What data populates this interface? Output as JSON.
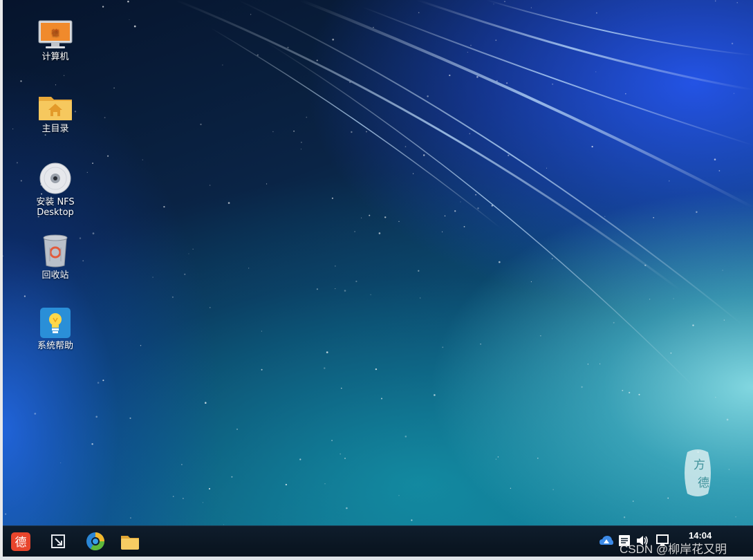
{
  "desktop": {
    "icons": [
      {
        "label": "计算机",
        "icon": "computer-icon"
      },
      {
        "label": "主目录",
        "icon": "home-folder-icon"
      },
      {
        "label": "安装 NFS",
        "label2": "Desktop",
        "icon": "disc-icon"
      },
      {
        "label": "回收站",
        "icon": "trash-icon"
      },
      {
        "label": "系统帮助",
        "icon": "lightbulb-icon"
      }
    ],
    "seal_text": "方德"
  },
  "taskbar": {
    "start_button_glyph": "德",
    "clock": "14:04",
    "buttons": [
      "show-desktop-icon",
      "browser-icon",
      "file-manager-icon"
    ],
    "tray": [
      "cloud-icon",
      "notes-icon",
      "volume-icon",
      "network-icon"
    ]
  },
  "watermark": "CSDN @柳岸花又明",
  "colors": {
    "taskbar": "#0f1d2c",
    "start_button": "#e8452c",
    "folder": "#f3c35a"
  }
}
